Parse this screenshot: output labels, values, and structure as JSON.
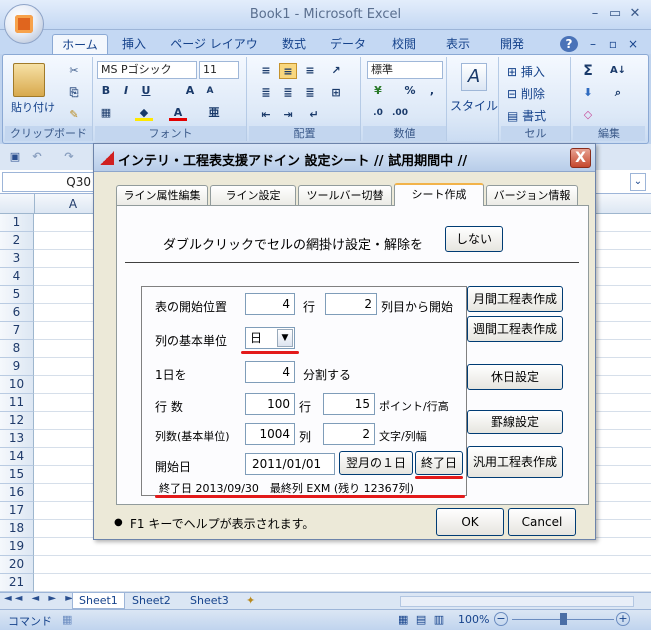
{
  "app": {
    "title": "Book1 - Microsoft Excel"
  },
  "ribbon": {
    "tabs": [
      "ホーム",
      "挿入",
      "ページ レイアウト",
      "数式",
      "データ",
      "校閲",
      "表示",
      "開発"
    ],
    "active_tab": "ホーム",
    "help": "?",
    "groups": {
      "clipboard": {
        "label": "クリップボード",
        "paste": "貼り付け"
      },
      "font": {
        "label": "フォント",
        "name": "MS Pゴシック",
        "size": "11",
        "grow": "A",
        "shrink": "A",
        "bold": "B",
        "italic": "I",
        "underline": "U",
        "font_color": "A"
      },
      "alignment": {
        "label": "配置"
      },
      "number": {
        "label": "数値",
        "format": "標準",
        "percent": "%",
        "comma": ","
      },
      "style": {
        "label": "スタイル"
      },
      "cells": {
        "label": "セル",
        "insert": "挿入",
        "delete": "削除",
        "format": "書式"
      },
      "editing": {
        "label": "編集"
      }
    }
  },
  "formula_bar": {
    "name_box": "Q30"
  },
  "grid": {
    "column_a": "A",
    "rows": [
      "1",
      "2",
      "3",
      "4",
      "5",
      "6",
      "7",
      "8",
      "9",
      "10",
      "11",
      "12",
      "13",
      "14",
      "15",
      "16",
      "17",
      "18",
      "19",
      "20",
      "21"
    ]
  },
  "sheet_tabs": [
    "Sheet1",
    "Sheet2",
    "Sheet3"
  ],
  "status": {
    "mode": "コマンド",
    "zoom": "100%"
  },
  "dialog": {
    "title": "インテリ・工程表支援アドイン 設定シート // 試用期間中 //",
    "close": "X",
    "tabs": [
      "ライン属性編集",
      "ライン設定",
      "ツールバー切替",
      "シート作成",
      "バージョン情報"
    ],
    "active_tab": "シート作成",
    "dblclick_label": "ダブルクリックでセルの網掛け設定・解除を",
    "dblclick_button": "しない",
    "start_pos_label": "表の開始位置",
    "start_row": "4",
    "row_unit": "行",
    "start_col": "2",
    "col_suffix": "列目から開始",
    "basic_unit_label": "列の基本単位",
    "basic_unit_value": "日",
    "split_label": "1日を",
    "split_value": "4",
    "split_suffix": "分割する",
    "rows_label": "行 数",
    "rows_value": "100",
    "rows_unit": "行",
    "point_value": "15",
    "point_suffix": "ポイント/行高",
    "cols_label": "列数(基本単位)",
    "cols_value": "1004",
    "cols_unit": "列",
    "chars_value": "2",
    "chars_suffix": "文字/列幅",
    "start_date_label": "開始日",
    "start_date": "2011/01/01",
    "next_month_button": "翌月の１日",
    "end_date_button": "終了日",
    "summary": "終了日 2013/09/30　最終列 EXM (残り 12367列)",
    "monthly_button": "月間工程表作成",
    "weekly_button": "週間工程表作成",
    "holiday_button": "休日設定",
    "border_button": "罫線設定",
    "general_button": "汎用工程表作成",
    "help_text": "F1 キーでヘルプが表示されます。",
    "ok_button": "OK",
    "cancel_button": "Cancel"
  }
}
